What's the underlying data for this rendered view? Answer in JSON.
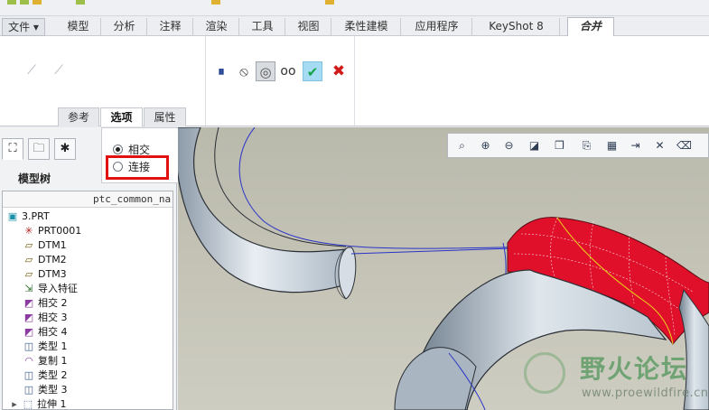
{
  "main_tabs": [
    {
      "label": "文件 ▾"
    },
    {
      "label": "模型"
    },
    {
      "label": "分析"
    },
    {
      "label": "注释"
    },
    {
      "label": "渲染"
    },
    {
      "label": "工具"
    },
    {
      "label": "视图"
    },
    {
      "label": "柔性建模"
    },
    {
      "label": "应用程序"
    },
    {
      "label": "KeyShot 8"
    },
    {
      "label": "合并"
    }
  ],
  "ribbon": {
    "subtabs": [
      {
        "label": "参考"
      },
      {
        "label": "选项"
      },
      {
        "label": "属性"
      }
    ],
    "icons": {
      "pause": "⏸",
      "no_preview": "⦸",
      "preview": "◎",
      "glasses": "oo",
      "ok": "✔",
      "cancel": "✖"
    }
  },
  "left_panel": {
    "tree_title": "模型树",
    "column_header": "ptc_common_na",
    "items": [
      {
        "label": "3.PRT",
        "icon": "part-icon"
      },
      {
        "label": "PRT0001",
        "icon": "csys-icon"
      },
      {
        "label": "DTM1",
        "icon": "plane-icon"
      },
      {
        "label": "DTM2",
        "icon": "plane-icon"
      },
      {
        "label": "DTM3",
        "icon": "plane-icon"
      },
      {
        "label": "导入特征",
        "icon": "import-icon"
      },
      {
        "label": "相交 2",
        "icon": "intersect-icon"
      },
      {
        "label": "相交 3",
        "icon": "intersect-icon"
      },
      {
        "label": "相交 4",
        "icon": "intersect-icon"
      },
      {
        "label": "类型 1",
        "icon": "surface-icon"
      },
      {
        "label": "复制 1",
        "icon": "copy-icon"
      },
      {
        "label": "类型 2",
        "icon": "surface-icon"
      },
      {
        "label": "类型 3",
        "icon": "surface-icon"
      },
      {
        "label": "拉伸 1",
        "icon": "extrude-icon"
      }
    ]
  },
  "options_popup": {
    "intersect_label": "相交",
    "connect_label": "连接"
  },
  "watermark": {
    "title": "野火论坛",
    "url": "www.proewildfire.cn"
  },
  "colors": {
    "accent_red": "#e11111",
    "surface_red": "#e0102a",
    "ok_green": "#17a34a"
  }
}
